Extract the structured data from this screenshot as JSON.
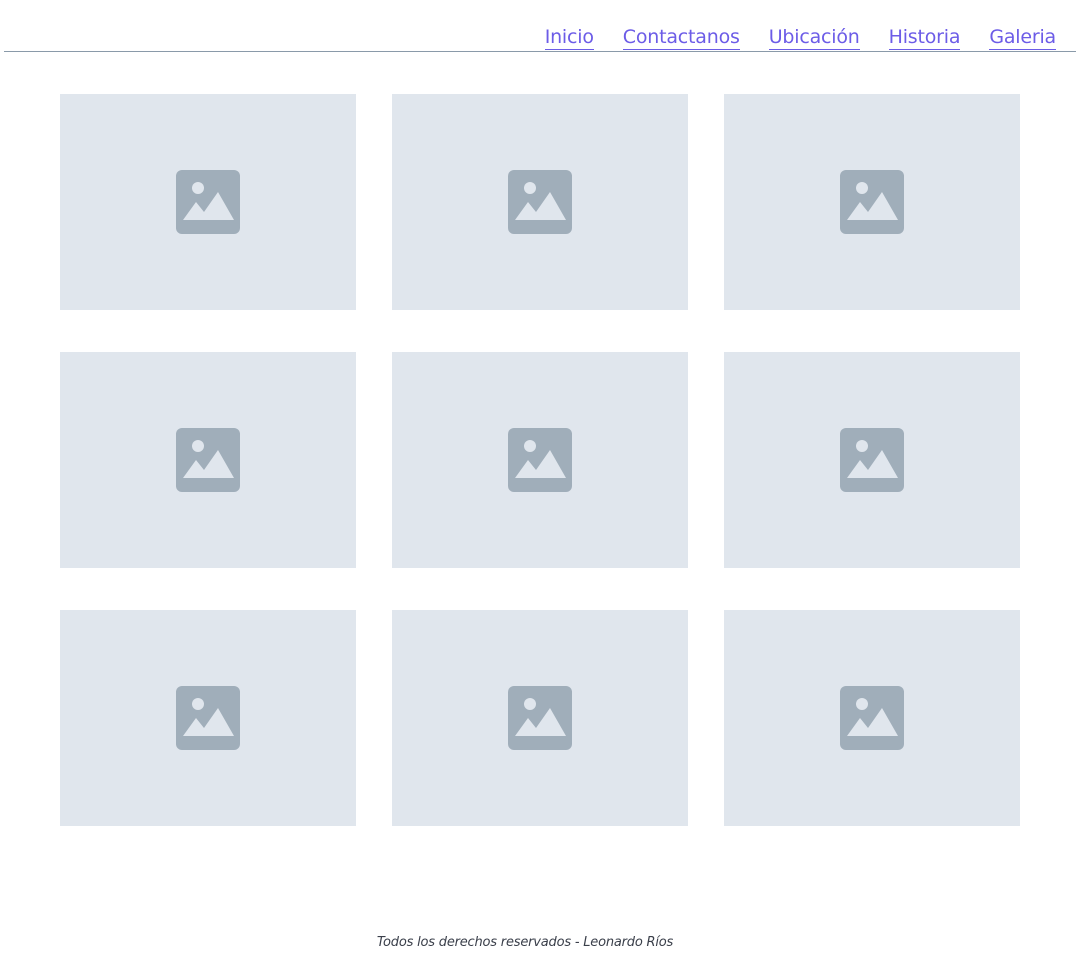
{
  "nav": {
    "items": [
      {
        "label": "Inicio"
      },
      {
        "label": "Contactanos"
      },
      {
        "label": "Ubicación"
      },
      {
        "label": "Historia"
      },
      {
        "label": "Galeria"
      }
    ]
  },
  "gallery": {
    "tiles": [
      {
        "icon": "image-placeholder-icon"
      },
      {
        "icon": "image-placeholder-icon"
      },
      {
        "icon": "image-placeholder-icon"
      },
      {
        "icon": "image-placeholder-icon"
      },
      {
        "icon": "image-placeholder-icon"
      },
      {
        "icon": "image-placeholder-icon"
      },
      {
        "icon": "image-placeholder-icon"
      },
      {
        "icon": "image-placeholder-icon"
      },
      {
        "icon": "image-placeholder-icon"
      }
    ]
  },
  "footer": {
    "text": "Todos los derechos reservados - Leonardo Ríos"
  },
  "colors": {
    "nav_link": "#6c5ce7",
    "tile_bg": "#e0e6ed",
    "icon": "#a0aeba",
    "divider": "#8a9aa9"
  }
}
